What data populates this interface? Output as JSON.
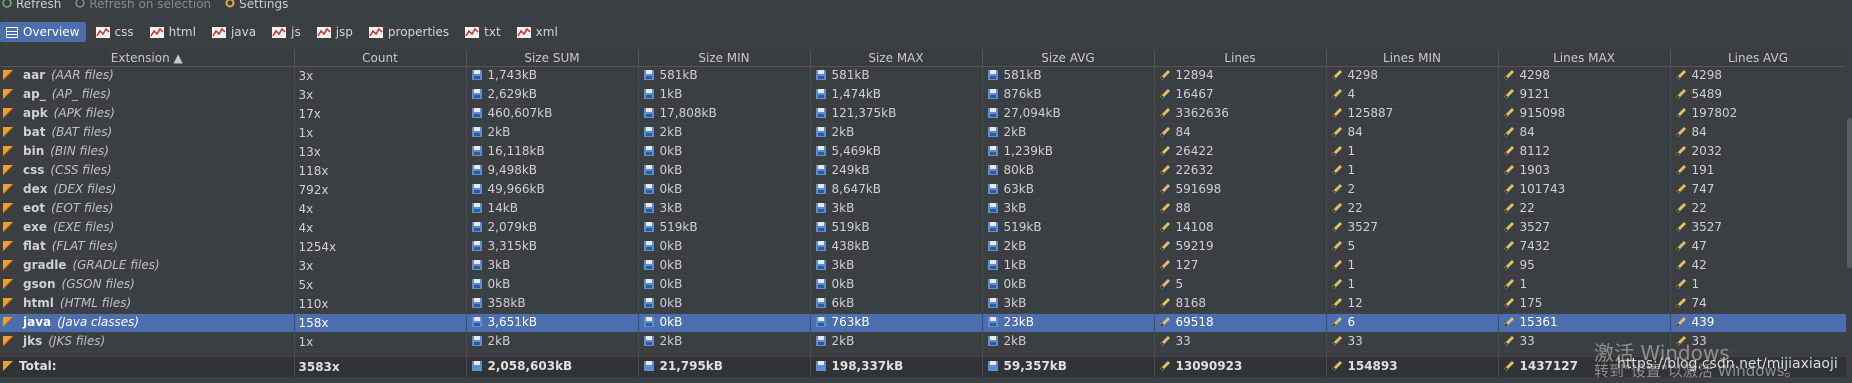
{
  "toolbar": {
    "refresh": "Refresh",
    "refresh_selection": "Refresh on selection",
    "settings": "Settings"
  },
  "tabs": [
    {
      "label": "Overview",
      "icon": "overview-icon",
      "active": true
    },
    {
      "label": "css",
      "icon": "chart-icon"
    },
    {
      "label": "html",
      "icon": "chart-icon"
    },
    {
      "label": "java",
      "icon": "chart-icon"
    },
    {
      "label": "js",
      "icon": "chart-icon"
    },
    {
      "label": "jsp",
      "icon": "chart-icon"
    },
    {
      "label": "properties",
      "icon": "chart-icon"
    },
    {
      "label": "txt",
      "icon": "chart-icon"
    },
    {
      "label": "xml",
      "icon": "chart-icon"
    }
  ],
  "columns": [
    "Extension ▲",
    "Count",
    "Size SUM",
    "Size MIN",
    "Size MAX",
    "Size AVG",
    "Lines",
    "Lines MIN",
    "Lines MAX",
    "Lines AVG"
  ],
  "rows": [
    {
      "ext": "aar",
      "desc": "(AAR files)",
      "count": "3x",
      "size_sum": "1,743kB",
      "size_min": "581kB",
      "size_max": "581kB",
      "size_avg": "581kB",
      "lines": "12894",
      "lines_min": "4298",
      "lines_max": "4298",
      "lines_avg": "4298"
    },
    {
      "ext": "ap_",
      "desc": "(AP_ files)",
      "count": "3x",
      "size_sum": "2,629kB",
      "size_min": "1kB",
      "size_max": "1,474kB",
      "size_avg": "876kB",
      "lines": "16467",
      "lines_min": "4",
      "lines_max": "9121",
      "lines_avg": "5489"
    },
    {
      "ext": "apk",
      "desc": "(APK files)",
      "count": "17x",
      "size_sum": "460,607kB",
      "size_min": "17,808kB",
      "size_max": "121,375kB",
      "size_avg": "27,094kB",
      "lines": "3362636",
      "lines_min": "125887",
      "lines_max": "915098",
      "lines_avg": "197802"
    },
    {
      "ext": "bat",
      "desc": "(BAT files)",
      "count": "1x",
      "size_sum": "2kB",
      "size_min": "2kB",
      "size_max": "2kB",
      "size_avg": "2kB",
      "lines": "84",
      "lines_min": "84",
      "lines_max": "84",
      "lines_avg": "84"
    },
    {
      "ext": "bin",
      "desc": "(BIN files)",
      "count": "13x",
      "size_sum": "16,118kB",
      "size_min": "0kB",
      "size_max": "5,469kB",
      "size_avg": "1,239kB",
      "lines": "26422",
      "lines_min": "1",
      "lines_max": "8112",
      "lines_avg": "2032"
    },
    {
      "ext": "css",
      "desc": "(CSS files)",
      "count": "118x",
      "size_sum": "9,498kB",
      "size_min": "0kB",
      "size_max": "249kB",
      "size_avg": "80kB",
      "lines": "22632",
      "lines_min": "1",
      "lines_max": "1903",
      "lines_avg": "191"
    },
    {
      "ext": "dex",
      "desc": "(DEX files)",
      "count": "792x",
      "size_sum": "49,966kB",
      "size_min": "0kB",
      "size_max": "8,647kB",
      "size_avg": "63kB",
      "lines": "591698",
      "lines_min": "2",
      "lines_max": "101743",
      "lines_avg": "747"
    },
    {
      "ext": "eot",
      "desc": "(EOT files)",
      "count": "4x",
      "size_sum": "14kB",
      "size_min": "3kB",
      "size_max": "3kB",
      "size_avg": "3kB",
      "lines": "88",
      "lines_min": "22",
      "lines_max": "22",
      "lines_avg": "22"
    },
    {
      "ext": "exe",
      "desc": "(EXE files)",
      "count": "4x",
      "size_sum": "2,079kB",
      "size_min": "519kB",
      "size_max": "519kB",
      "size_avg": "519kB",
      "lines": "14108",
      "lines_min": "3527",
      "lines_max": "3527",
      "lines_avg": "3527"
    },
    {
      "ext": "flat",
      "desc": "(FLAT files)",
      "count": "1254x",
      "size_sum": "3,315kB",
      "size_min": "0kB",
      "size_max": "438kB",
      "size_avg": "2kB",
      "lines": "59219",
      "lines_min": "5",
      "lines_max": "7432",
      "lines_avg": "47"
    },
    {
      "ext": "gradle",
      "desc": "(GRADLE files)",
      "count": "3x",
      "size_sum": "3kB",
      "size_min": "0kB",
      "size_max": "3kB",
      "size_avg": "1kB",
      "lines": "127",
      "lines_min": "1",
      "lines_max": "95",
      "lines_avg": "42"
    },
    {
      "ext": "gson",
      "desc": "(GSON files)",
      "count": "5x",
      "size_sum": "0kB",
      "size_min": "0kB",
      "size_max": "0kB",
      "size_avg": "0kB",
      "lines": "5",
      "lines_min": "1",
      "lines_max": "1",
      "lines_avg": "1"
    },
    {
      "ext": "html",
      "desc": "(HTML files)",
      "count": "110x",
      "size_sum": "358kB",
      "size_min": "0kB",
      "size_max": "6kB",
      "size_avg": "3kB",
      "lines": "8168",
      "lines_min": "12",
      "lines_max": "175",
      "lines_avg": "74"
    },
    {
      "ext": "java",
      "desc": "(Java classes)",
      "count": "158x",
      "size_sum": "3,651kB",
      "size_min": "0kB",
      "size_max": "763kB",
      "size_avg": "23kB",
      "lines": "69518",
      "lines_min": "6",
      "lines_max": "15361",
      "lines_avg": "439",
      "selected": true
    },
    {
      "ext": "jks",
      "desc": "(JKS files)",
      "count": "1x",
      "size_sum": "2kB",
      "size_min": "2kB",
      "size_max": "2kB",
      "size_avg": "2kB",
      "lines": "33",
      "lines_min": "33",
      "lines_max": "33",
      "lines_avg": "33"
    }
  ],
  "total": {
    "label": "Total:",
    "count": "3583x",
    "size_sum": "2,058,603kB",
    "size_min": "21,795kB",
    "size_max": "198,337kB",
    "size_avg": "59,357kB",
    "lines": "13090923",
    "lines_min": "154893",
    "lines_max": "1437127",
    "lines_avg": ""
  },
  "overlay": {
    "watermark": "激活 Windows",
    "watermark_sub": "转到\"设置\"以激活 Windows。",
    "url": "https://blog.csdn.net/mijiaxiaoji"
  },
  "colors": {
    "background": "#3c3f41",
    "selection": "#4b6eaf",
    "header": "#3a3d3f",
    "ext_icon": "#f0a030",
    "disk_icon": "#5b8fd1",
    "pen_icon": "#e0c060"
  }
}
